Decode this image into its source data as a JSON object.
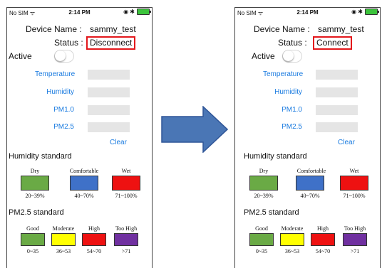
{
  "status_bar": {
    "carrier": "No SIM",
    "wifi_icon": "wifi-icon",
    "time": "2:14 PM",
    "right_icons": "◉ ✱"
  },
  "labels": {
    "device_name": "Device Name :",
    "status": "Status :",
    "active": "Active"
  },
  "device_name_value": "sammy_test",
  "sensors": [
    "Temperature",
    "Humidity",
    "PM1.0",
    "PM2.5"
  ],
  "clear_label": "Clear",
  "humidity_standard": {
    "title": "Humidity standard",
    "items": [
      {
        "name": "Dry",
        "range": "20~39%",
        "color": "#6aaa45"
      },
      {
        "name": "Comfortable",
        "range": "40~70%",
        "color": "#3f71c8"
      },
      {
        "name": "Wet",
        "range": "71~100%",
        "color": "#ee1111"
      }
    ]
  },
  "pm25_standard": {
    "title": "PM2.5 standard",
    "items": [
      {
        "name": "Good",
        "range": "0~35",
        "color": "#6aaa45"
      },
      {
        "name": "Moderate",
        "range": "36~53",
        "color": "#ffff00"
      },
      {
        "name": "High",
        "range": "54~70",
        "color": "#ee1111"
      },
      {
        "name": "Too High",
        "range": ">71",
        "color": "#7030a0"
      }
    ]
  },
  "left_screen": {
    "status_value": "Disconnect"
  },
  "right_screen": {
    "status_value": "Connect"
  },
  "arrow_color": "#4a76b5"
}
